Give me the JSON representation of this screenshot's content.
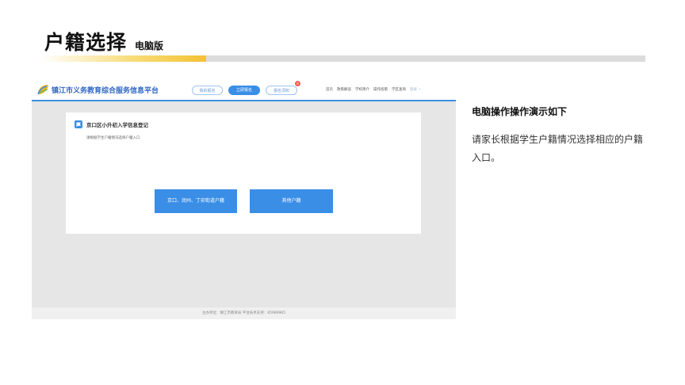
{
  "slide": {
    "title": "户籍选择",
    "subtitle": "电脑版",
    "side_title": "电脑操作操作演示如下",
    "side_text": "请家长根据学生户籍情况选择相应的户籍入口。"
  },
  "screenshot": {
    "site_name": "镇江市义务教育综合服务信息平台",
    "pills": [
      "我的报名",
      "立即报名",
      "报名须知"
    ],
    "badge_count": "8",
    "menu": [
      "首页",
      "政策解读",
      "学校简介",
      "操作指南",
      "学区查询",
      "登录 ~"
    ],
    "card_title": "京口区小升初入学信息登记",
    "card_hint": "请根据学生户籍情况选择户籍入口",
    "button_local": "京口、润州、丁卯街道户籍",
    "button_other": "其他户籍",
    "footer": "主办单位：镇江市教育局    平台技术支持：85989965"
  },
  "colors": {
    "accent": "#3a8ee6",
    "title_bar_yellow": "#f4c233",
    "badge_red": "#ef5a4e"
  }
}
